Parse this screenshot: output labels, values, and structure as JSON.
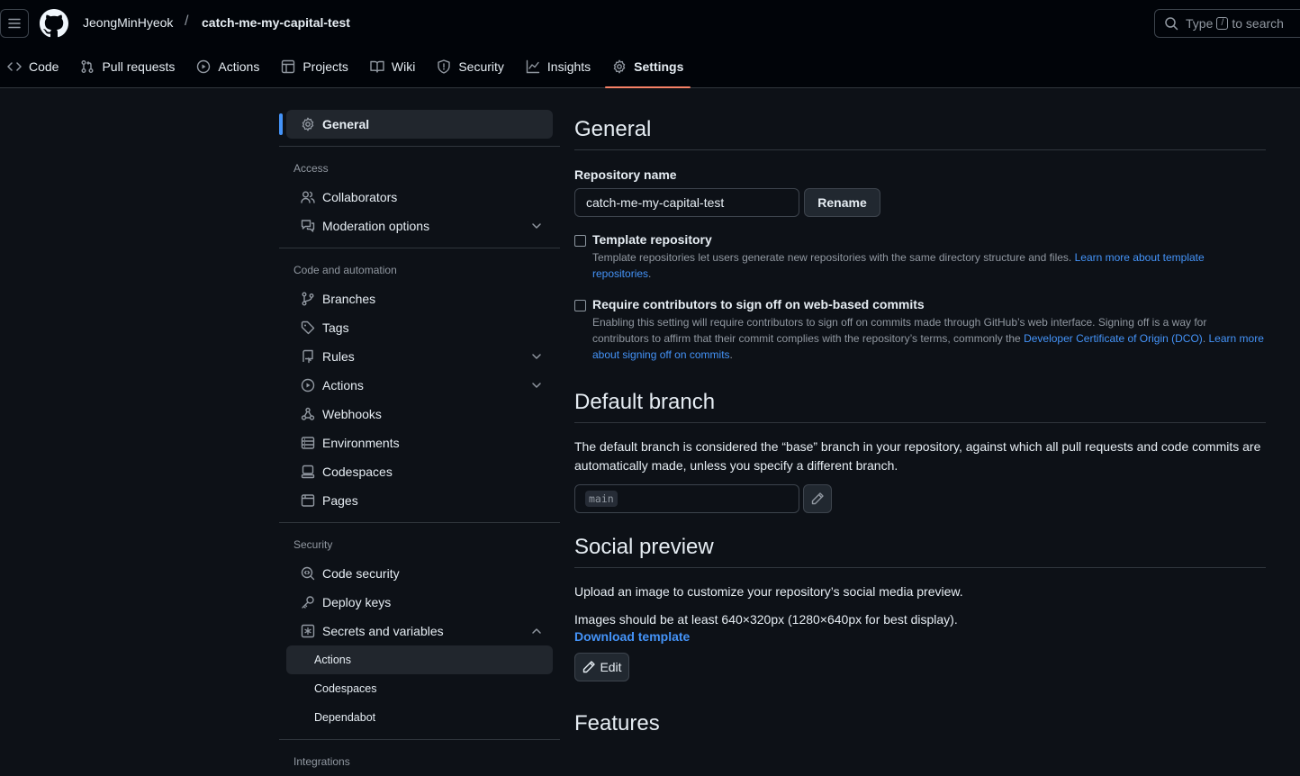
{
  "header": {
    "owner": "JeongMinHyeok",
    "separator": "/",
    "repo": "catch-me-my-capital-test",
    "search": {
      "prefix": "Type",
      "key": "/",
      "suffix": "to search"
    }
  },
  "tabs": [
    {
      "label": "Code",
      "icon": "code-icon"
    },
    {
      "label": "Pull requests",
      "icon": "pull-request-icon"
    },
    {
      "label": "Actions",
      "icon": "play-icon"
    },
    {
      "label": "Projects",
      "icon": "table-icon"
    },
    {
      "label": "Wiki",
      "icon": "book-icon"
    },
    {
      "label": "Security",
      "icon": "shield-icon"
    },
    {
      "label": "Insights",
      "icon": "graph-icon"
    },
    {
      "label": "Settings",
      "icon": "gear-icon",
      "active": true
    }
  ],
  "sidebar": {
    "general": "General",
    "groups": {
      "access": "Access",
      "code_automation": "Code and automation",
      "security": "Security",
      "integrations": "Integrations"
    },
    "items": {
      "collaborators": "Collaborators",
      "moderation": "Moderation options",
      "branches": "Branches",
      "tags": "Tags",
      "rules": "Rules",
      "actions": "Actions",
      "webhooks": "Webhooks",
      "environments": "Environments",
      "codespaces": "Codespaces",
      "pages": "Pages",
      "code_security": "Code security",
      "deploy_keys": "Deploy keys",
      "secrets": "Secrets and variables"
    },
    "secrets_sub": [
      "Actions",
      "Codespaces",
      "Dependabot"
    ]
  },
  "main": {
    "general_title": "General",
    "repo_name_label": "Repository name",
    "repo_name_value": "catch-me-my-capital-test",
    "rename_label": "Rename",
    "template": {
      "title": "Template repository",
      "desc": "Template repositories let users generate new repositories with the same directory structure and files.",
      "link": "Learn more about template repositories",
      "end": "."
    },
    "signoff": {
      "title": "Require contributors to sign off on web-based commits",
      "desc": "Enabling this setting will require contributors to sign off on commits made through GitHub’s web interface. Signing off is a way for contributors to affirm that their commit complies with the repository’s terms, commonly the",
      "link1": "Developer Certificate of Origin (DCO)",
      "mid": ".",
      "link2": "Learn more about signing off on commits",
      "end": "."
    },
    "default_branch_title": "Default branch",
    "default_branch_desc": "The default branch is considered the “base” branch in your repository, against which all pull requests and code commits are automatically made, unless you specify a different branch.",
    "default_branch_value": "main",
    "social_title": "Social preview",
    "social_desc1": "Upload an image to customize your repository’s social media preview.",
    "social_desc2": "Images should be at least 640×320px (1280×640px for best display).",
    "download_template": "Download template",
    "edit_label": "Edit",
    "features_title": "Features"
  },
  "colors": {
    "bg": "#0d1117",
    "header_bg": "#010409",
    "accent": "#4493f8",
    "tab_underline": "#f78166",
    "border": "#30363d"
  }
}
